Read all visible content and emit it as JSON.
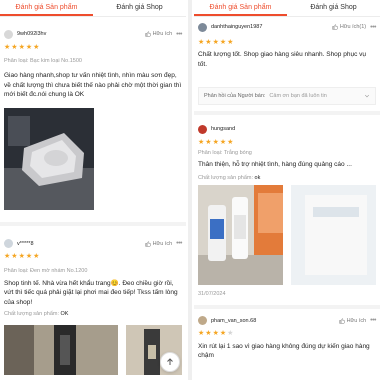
{
  "tabs": {
    "product": "Đánh giá Sản phẩm",
    "shop": "Đánh giá Shop"
  },
  "left": {
    "review1": {
      "username": "9wh092l3hv",
      "likes_label": "Hữu ích",
      "more": "•••",
      "rating": 5,
      "variant": "Phân loại: Bạc kim loại No.1500",
      "text": "Giao hàng nhanh,shop tư vấn nhiệt tình, nhìn màu sơn đẹp, về chất lượng thì chưa biết thế nào phải chờ một thời gian thì mới biết đc.nói chung là OK"
    },
    "review2": {
      "username": "v*****8",
      "likes_label": "Hữu ích",
      "more": "•••",
      "rating": 5,
      "variant": "Phân loại: Đen mờ nhám No.1200",
      "text": "Shop tinh tế. Nhà vừa hết khẩu trang😊. Đeo chiều giờ rồi, vứt thì tiếc quá phải giặt lại phơi mai đeo tiếp! Tkss tấm lòng của shop!",
      "attr_label": "Chất lượng sản phẩm:",
      "attr_value": "OK"
    }
  },
  "right": {
    "review1": {
      "username": "danhthainguyen1987",
      "likes_label": "Hữu ích(1)",
      "more": "•••",
      "rating": 5,
      "text": "Chất lượng tốt. Shop giao hàng siêu nhanh. Shop phục vụ tốt."
    },
    "seller_reply": {
      "label": "Phản hồi của Người bán:",
      "value": "Cảm ơn bạn đã luôn tin"
    },
    "review2": {
      "username": "hungsand",
      "likes_label": "Hữu ích",
      "more": "•••",
      "rating": 5,
      "variant": "Phân loại: Trắng bóng",
      "text": "Thân thiện, hỗ trợ nhiệt tình, hàng đúng quảng cáo ...",
      "attr_label": "Chất lượng sản phẩm:",
      "attr_value": "ok",
      "date": "31/07/2024"
    },
    "review3": {
      "username": "pham_van_son.68",
      "likes_label": "Hữu ích",
      "more": "•••",
      "rating": 4,
      "text": "Xin rút lại 1 sao vì giao hàng không đúng dự kiến giao hàng chậm"
    }
  },
  "colors": {
    "accent": "#ee4d2d",
    "star": "#f5a623"
  },
  "icons": {
    "like": "thumbs-up-icon",
    "more": "more-dots-icon",
    "scroll_top": "arrow-up-icon",
    "seller_expand": "chevron-down-icon"
  }
}
